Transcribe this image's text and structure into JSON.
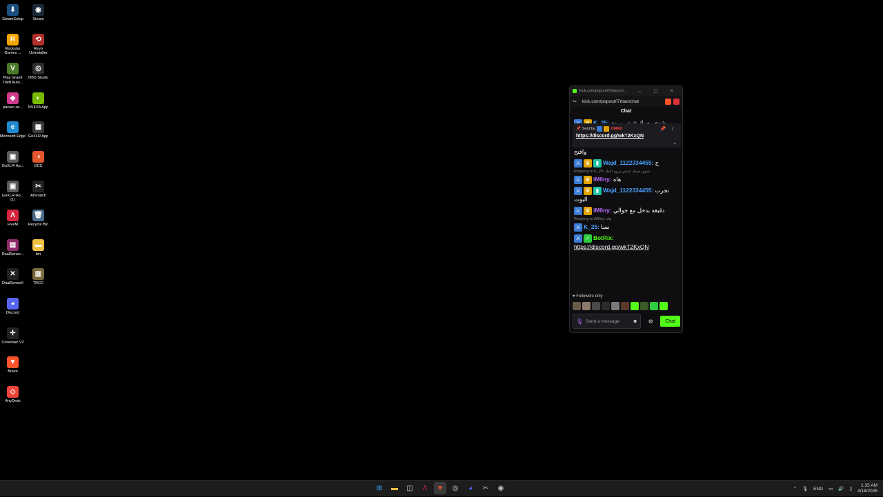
{
  "desktop": {
    "icons": [
      {
        "label": "SteamSetup",
        "icon": "steam-setup-icon",
        "color": "#1b4f80",
        "glyph": "⬇"
      },
      {
        "label": "Steam",
        "icon": "steam-icon",
        "color": "#1b2838",
        "glyph": "◉"
      },
      {
        "label": "Rockstar Games ...",
        "icon": "rockstar-icon",
        "color": "#f5a400",
        "glyph": "R"
      },
      {
        "label": "Revo Uninstaller",
        "icon": "revo-icon",
        "color": "#b0302a",
        "glyph": "⟲"
      },
      {
        "label": "Play Grand Theft Auto...",
        "icon": "gta-icon",
        "color": "#4a7a2a",
        "glyph": "V"
      },
      {
        "label": "OBS Studio",
        "icon": "obs-icon",
        "color": "#302e31",
        "glyph": "◎"
      },
      {
        "label": "parsec-wi...",
        "icon": "parsec-icon",
        "color": "#d03a8c",
        "glyph": "◆"
      },
      {
        "label": "NVIDIA App",
        "icon": "nvidia-icon",
        "color": "#76b900",
        "glyph": "◐"
      },
      {
        "label": "Microsoft Edge",
        "icon": "edge-icon",
        "color": "#1f8ad2",
        "glyph": "e"
      },
      {
        "label": "GoXLR App",
        "icon": "goxlr-icon",
        "color": "#3a3a3a",
        "glyph": "▦"
      },
      {
        "label": "GoXLR-Ap...",
        "icon": "goxlr-installer-icon",
        "color": "#5a5a5a",
        "glyph": "▣"
      },
      {
        "label": "GCC",
        "icon": "gcc-icon",
        "color": "#e4572e",
        "glyph": "◑"
      },
      {
        "label": "GoXLR-Ap... (1)",
        "icon": "goxlr-installer-icon",
        "color": "#5a5a5a",
        "glyph": "▣"
      },
      {
        "label": "AISnatch",
        "icon": "aisnatch-icon",
        "color": "#222",
        "glyph": "✂"
      },
      {
        "label": "FiveM",
        "icon": "fivem-icon",
        "color": "#d7263d",
        "glyph": "Λ"
      },
      {
        "label": "Recycle Bin",
        "icon": "recycle-bin-icon",
        "color": "#4d6d8c",
        "glyph": "🗑"
      },
      {
        "label": "DualSense...",
        "icon": "winrar-icon",
        "color": "#8c2a6a",
        "glyph": "▤"
      },
      {
        "label": "bin",
        "icon": "folder-icon",
        "color": "#f0c040",
        "glyph": "▬"
      },
      {
        "label": "DualSenseX",
        "icon": "dualsensex-icon",
        "color": "#222",
        "glyph": "✕"
      },
      {
        "label": "TRCC",
        "icon": "trcc-icon",
        "color": "#7a6a3a",
        "glyph": "▥"
      },
      {
        "label": "Discord",
        "icon": "discord-icon",
        "color": "#5865f2",
        "glyph": "◕"
      },
      {
        "label": "",
        "icon": "",
        "color": "",
        "glyph": ""
      },
      {
        "label": "Crosshair V2",
        "icon": "crosshair-icon",
        "color": "#222",
        "glyph": "✛"
      },
      {
        "label": "",
        "icon": "",
        "color": "",
        "glyph": ""
      },
      {
        "label": "Brave",
        "icon": "brave-icon",
        "color": "#fb542b",
        "glyph": "▼"
      },
      {
        "label": "",
        "icon": "",
        "color": "",
        "glyph": ""
      },
      {
        "label": "AnyDesk",
        "icon": "anydesk-icon",
        "color": "#ef443b",
        "glyph": "◇"
      }
    ]
  },
  "window": {
    "tab_url": "kick.com/popout/l7rban/ch...",
    "address": "kick.com/popout/l7rban/chat",
    "minimize": "–",
    "maximize": "▢",
    "close": "✕",
    "chat_title": "Chat"
  },
  "pinned": {
    "sent_by": "Sent by",
    "username": "OMAD",
    "link": "https://discord.gg/wkT2KxQN"
  },
  "messages": [
    {
      "user": "K_25",
      "user_color": "blue",
      "badges": [
        "sword",
        "crown"
      ],
      "text": "شوي يصيك تثبيتي بروم التيك",
      "reply": ""
    },
    {
      "user": "Wajd_1122334455",
      "user_color": "blue",
      "badges": [
        "sword",
        "crown",
        "sub"
      ],
      "text": "قفل واقتح",
      "reply": ""
    },
    {
      "user": "Wajd_1122334455",
      "user_color": "blue",
      "badges": [
        "sword",
        "crown",
        "sub"
      ],
      "text": "ح",
      "reply": ""
    },
    {
      "user": "iM0ny",
      "user_color": "purple",
      "badges": [
        "sword",
        "crown"
      ],
      "text": "هاه",
      "reply": "Replying to K_25: شوي يصيك تثبيتي بروم التيك"
    },
    {
      "user": "Wajd_1122334455",
      "user_color": "blue",
      "badges": [
        "sword",
        "crown",
        "sub"
      ],
      "text": "نجرب البوت",
      "reply": ""
    },
    {
      "user": "iM0ny",
      "user_color": "purple",
      "badges": [
        "sword",
        "crown"
      ],
      "text": "دقيقه بدخل مع جوالي",
      "reply": ""
    },
    {
      "user": "K_25",
      "user_color": "blue",
      "badges": [
        "sword"
      ],
      "text": "نسا",
      "reply": "Replying to iM0ny: هاه"
    },
    {
      "user": "BotRix",
      "user_color": "green",
      "badges": [
        "sword",
        "bot"
      ],
      "text": "https://discord.gg/wkT2KxQN",
      "reply": ""
    }
  ],
  "footer": {
    "followers_only": "Followers only",
    "input_placeholder": "Send a message",
    "chat_button": "Chat"
  },
  "taskbar": {
    "language": "ENG",
    "time": "1:35 AM",
    "date": "4/18/2026"
  }
}
